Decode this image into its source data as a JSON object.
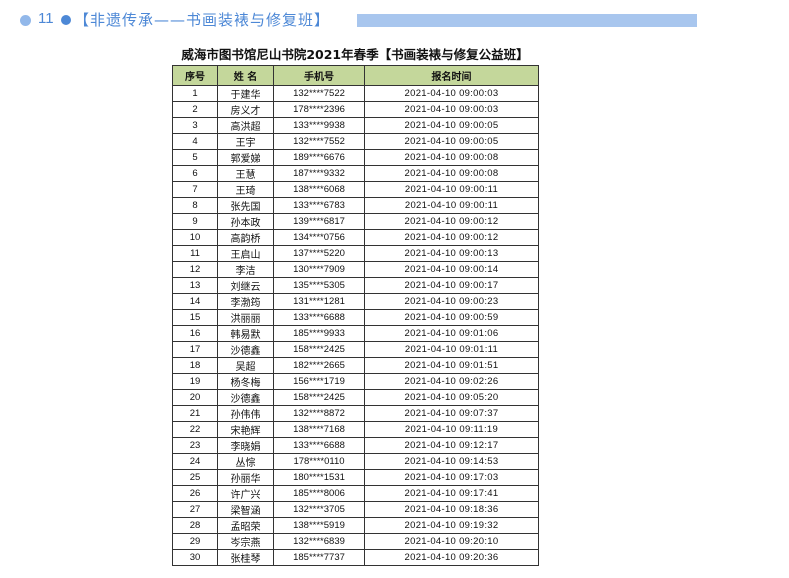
{
  "section": {
    "number": "11",
    "title": "【非遗传承——书画装裱与修复班】"
  },
  "document": {
    "title": "威海市图书馆尼山书院2021年春季【书画装裱与修复公益班】"
  },
  "table": {
    "headers": [
      "序号",
      "姓 名",
      "手机号",
      "报名时间"
    ],
    "rows": [
      [
        "1",
        "于建华",
        "132****7522",
        "2021-04-10 09:00:03"
      ],
      [
        "2",
        "房义才",
        "178****2396",
        "2021-04-10 09:00:03"
      ],
      [
        "3",
        "高洪超",
        "133****9938",
        "2021-04-10 09:00:05"
      ],
      [
        "4",
        "王宇",
        "132****7552",
        "2021-04-10 09:00:05"
      ],
      [
        "5",
        "郭爱娣",
        "189****6676",
        "2021-04-10 09:00:08"
      ],
      [
        "6",
        "王慧",
        "187****9332",
        "2021-04-10 09:00:08"
      ],
      [
        "7",
        "王琦",
        "138****6068",
        "2021-04-10 09:00:11"
      ],
      [
        "8",
        "张先国",
        "133****6783",
        "2021-04-10 09:00:11"
      ],
      [
        "9",
        "孙本政",
        "139****6817",
        "2021-04-10 09:00:12"
      ],
      [
        "10",
        "高韵桥",
        "134****0756",
        "2021-04-10 09:00:12"
      ],
      [
        "11",
        "王启山",
        "137****5220",
        "2021-04-10 09:00:13"
      ],
      [
        "12",
        "李洁",
        "130****7909",
        "2021-04-10 09:00:14"
      ],
      [
        "13",
        "刘继云",
        "135****5305",
        "2021-04-10 09:00:17"
      ],
      [
        "14",
        "李渤筠",
        "131****1281",
        "2021-04-10 09:00:23"
      ],
      [
        "15",
        "洪丽丽",
        "133****6688",
        "2021-04-10 09:00:59"
      ],
      [
        "16",
        "韩易默",
        "185****9933",
        "2021-04-10 09:01:06"
      ],
      [
        "17",
        "沙德鑫",
        "158****2425",
        "2021-04-10 09:01:11"
      ],
      [
        "18",
        "吴超",
        "182****2665",
        "2021-04-10 09:01:51"
      ],
      [
        "19",
        "杨冬梅",
        "156****1719",
        "2021-04-10 09:02:26"
      ],
      [
        "20",
        "沙德鑫",
        "158****2425",
        "2021-04-10 09:05:20"
      ],
      [
        "21",
        "孙伟伟",
        "132****8872",
        "2021-04-10 09:07:37"
      ],
      [
        "22",
        "宋艳辉",
        "138****7168",
        "2021-04-10 09:11:19"
      ],
      [
        "23",
        "李晓娟",
        "133****6688",
        "2021-04-10 09:12:17"
      ],
      [
        "24",
        "丛悰",
        "178****0110",
        "2021-04-10 09:14:53"
      ],
      [
        "25",
        "孙丽华",
        "180****1531",
        "2021-04-10 09:17:03"
      ],
      [
        "26",
        "许广兴",
        "185****8006",
        "2021-04-10 09:17:41"
      ],
      [
        "27",
        "梁智涵",
        "132****3705",
        "2021-04-10 09:18:36"
      ],
      [
        "28",
        "孟昭荣",
        "138****5919",
        "2021-04-10 09:19:32"
      ],
      [
        "29",
        "岑宗燕",
        "132****6839",
        "2021-04-10 09:20:10"
      ],
      [
        "30",
        "张桂琴",
        "185****7737",
        "2021-04-10 09:20:36"
      ]
    ]
  },
  "colors": {
    "accent": "#4d88d6",
    "accent_light": "#a8c6ee",
    "header_fill": "#c4d79b"
  }
}
